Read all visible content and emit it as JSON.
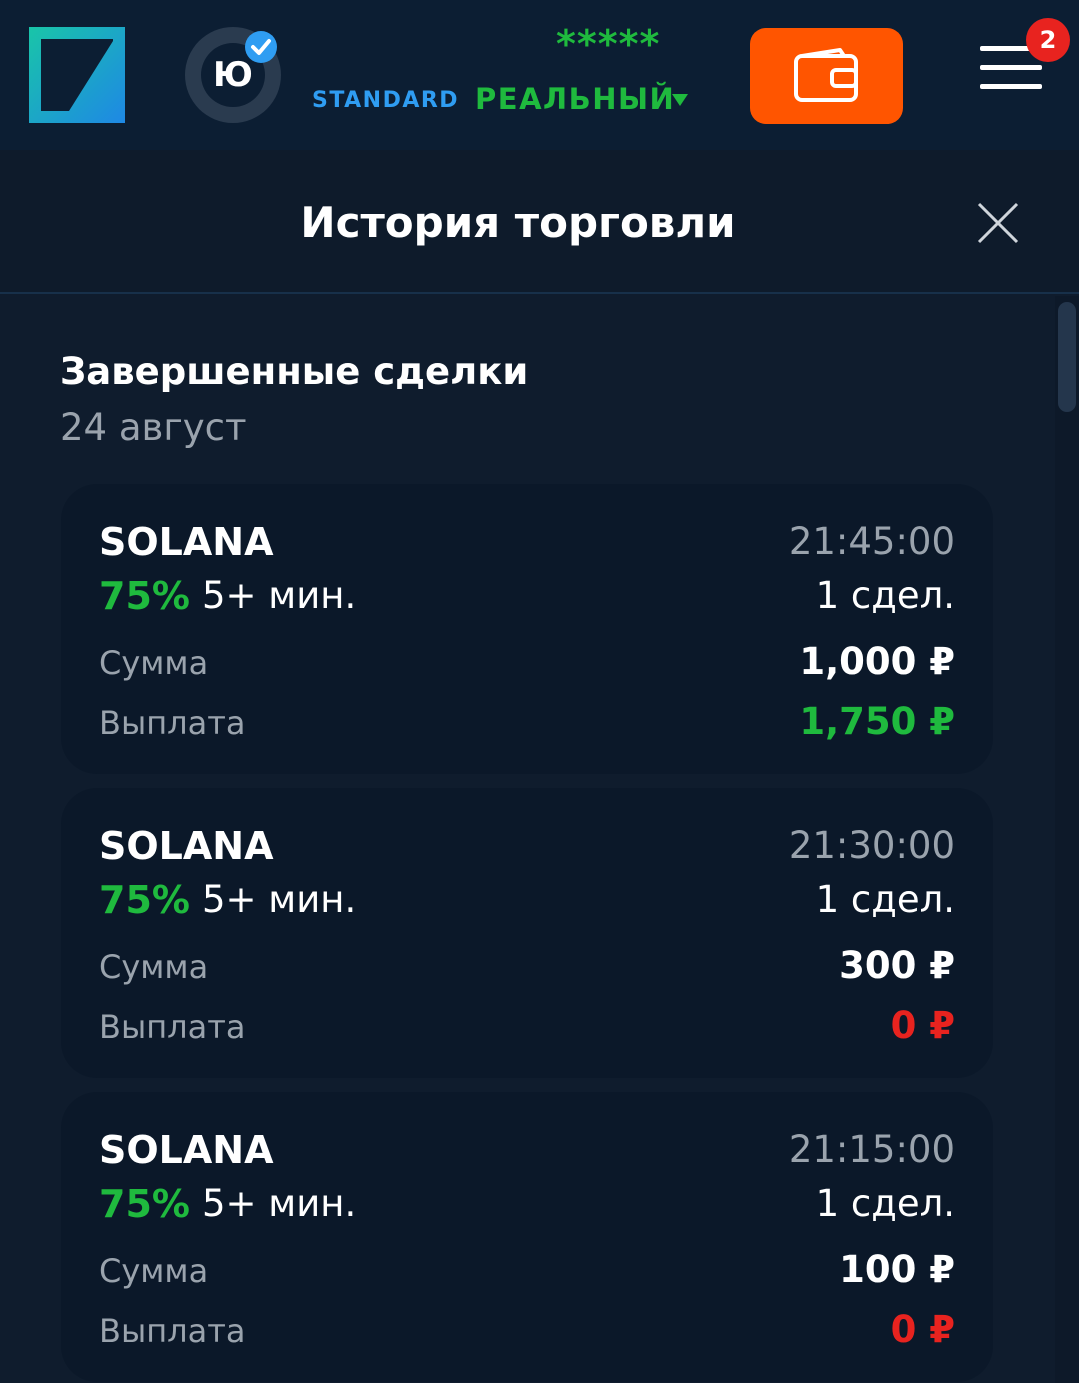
{
  "header": {
    "avatar_text": "Ю",
    "account_type": "STANDARD",
    "rating": "*****",
    "account_mode": "РЕАЛЬНЫЙ",
    "notifications_count": "2",
    "colors": {
      "brand_green": "#1fba3e",
      "wallet_orange": "#ff5500",
      "standard_blue": "#2f9df2",
      "badge_red": "#e8231f"
    },
    "icons": [
      "logo-icon",
      "verified-icon",
      "caret-down-icon",
      "wallet-icon",
      "menu-icon"
    ]
  },
  "panel": {
    "title": "История торговли",
    "close_icon": "close-icon"
  },
  "history": {
    "section_title": "Завершенные сделки",
    "date": "24 август",
    "label_sum": "Сумма",
    "label_payout": "Выплата",
    "trades": [
      {
        "asset": "SOLANA",
        "percent": "75%",
        "duration": "5+ мин.",
        "time": "21:45:00",
        "count": "1 сдел.",
        "amount": "1,000 ₽",
        "payout": "1,750 ₽",
        "result": "win"
      },
      {
        "asset": "SOLANA",
        "percent": "75%",
        "duration": "5+ мин.",
        "time": "21:30:00",
        "count": "1 сдел.",
        "amount": "300 ₽",
        "payout": "0 ₽",
        "result": "loss"
      },
      {
        "asset": "SOLANA",
        "percent": "75%",
        "duration": "5+ мин.",
        "time": "21:15:00",
        "count": "1 сдел.",
        "amount": "100 ₽",
        "payout": "0 ₽",
        "result": "loss"
      }
    ]
  }
}
